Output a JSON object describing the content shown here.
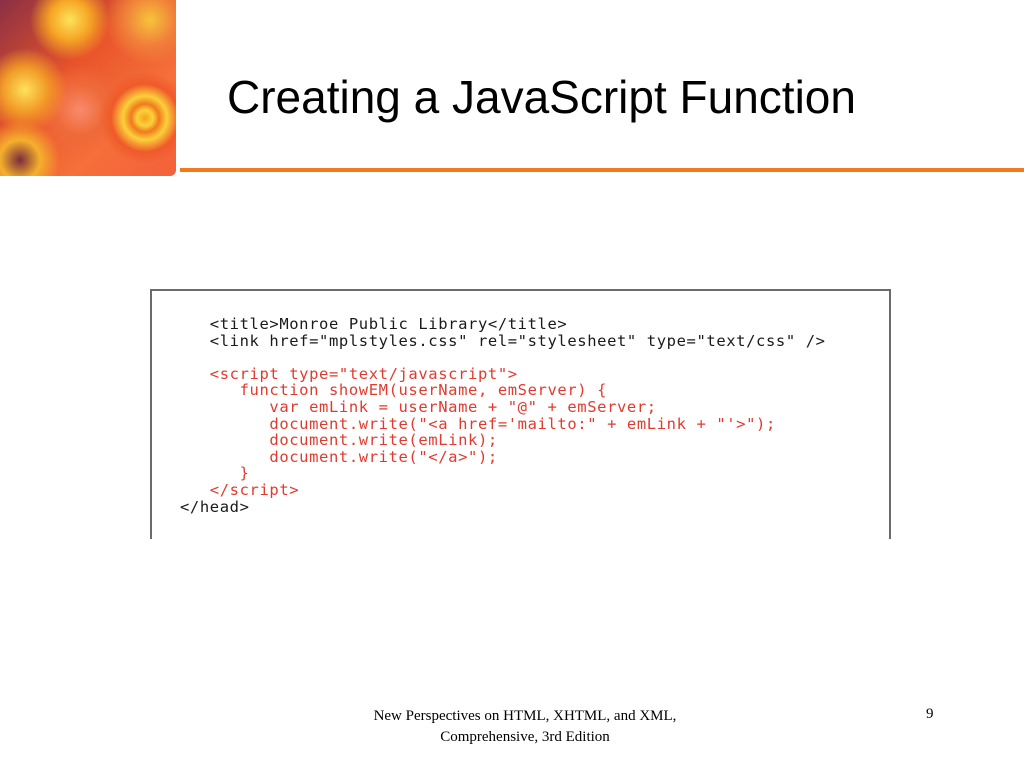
{
  "slide": {
    "title": "Creating a JavaScript Function",
    "code_lines": [
      {
        "text": "<title>Monroe Public Library</title>",
        "indent": 1,
        "color": "black"
      },
      {
        "text": "<link href=\"mplstyles.css\" rel=\"stylesheet\" type=\"text/css\" />",
        "indent": 1,
        "color": "black"
      },
      {
        "text": "",
        "indent": 0,
        "color": "black"
      },
      {
        "text": "<script type=\"text/javascript\">",
        "indent": 1,
        "color": "red"
      },
      {
        "text": "function showEM(userName, emServer) {",
        "indent": 2,
        "color": "red"
      },
      {
        "text": "var emLink = userName + \"@\" + emServer;",
        "indent": 3,
        "color": "red"
      },
      {
        "text": "document.write(\"<a href='mailto:\" + emLink + \"'>\");",
        "indent": 3,
        "color": "red"
      },
      {
        "text": "document.write(emLink);",
        "indent": 3,
        "color": "red"
      },
      {
        "text": "document.write(\"</a>\");",
        "indent": 3,
        "color": "red"
      },
      {
        "text": "}",
        "indent": 2,
        "color": "red"
      },
      {
        "text": "</script>",
        "indent": 1,
        "color": "red"
      },
      {
        "text": "</head>",
        "indent": 0,
        "color": "black"
      }
    ],
    "footer_line1": "New Perspectives on HTML, XHTML, and XML,",
    "footer_line2": "Comprehensive, 3rd Edition",
    "page_number": "9",
    "accent_color": "#f07a1c",
    "code_highlight_color": "#e23a2e"
  }
}
